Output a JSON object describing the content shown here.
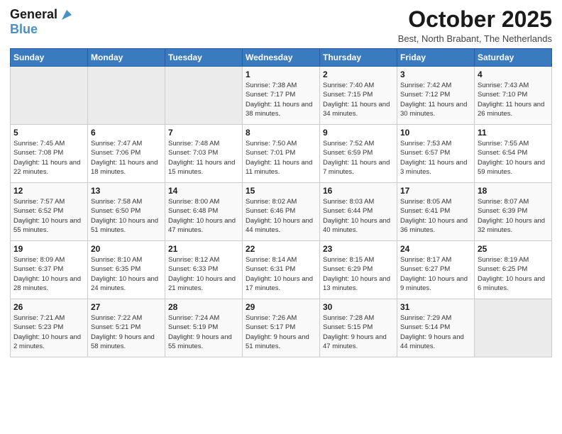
{
  "header": {
    "logo_line1": "General",
    "logo_line2": "Blue",
    "month": "October 2025",
    "location": "Best, North Brabant, The Netherlands"
  },
  "days_of_week": [
    "Sunday",
    "Monday",
    "Tuesday",
    "Wednesday",
    "Thursday",
    "Friday",
    "Saturday"
  ],
  "weeks": [
    [
      {
        "day": "",
        "info": ""
      },
      {
        "day": "",
        "info": ""
      },
      {
        "day": "",
        "info": ""
      },
      {
        "day": "1",
        "info": "Sunrise: 7:38 AM\nSunset: 7:17 PM\nDaylight: 11 hours\nand 38 minutes."
      },
      {
        "day": "2",
        "info": "Sunrise: 7:40 AM\nSunset: 7:15 PM\nDaylight: 11 hours\nand 34 minutes."
      },
      {
        "day": "3",
        "info": "Sunrise: 7:42 AM\nSunset: 7:12 PM\nDaylight: 11 hours\nand 30 minutes."
      },
      {
        "day": "4",
        "info": "Sunrise: 7:43 AM\nSunset: 7:10 PM\nDaylight: 11 hours\nand 26 minutes."
      }
    ],
    [
      {
        "day": "5",
        "info": "Sunrise: 7:45 AM\nSunset: 7:08 PM\nDaylight: 11 hours\nand 22 minutes."
      },
      {
        "day": "6",
        "info": "Sunrise: 7:47 AM\nSunset: 7:06 PM\nDaylight: 11 hours\nand 18 minutes."
      },
      {
        "day": "7",
        "info": "Sunrise: 7:48 AM\nSunset: 7:03 PM\nDaylight: 11 hours\nand 15 minutes."
      },
      {
        "day": "8",
        "info": "Sunrise: 7:50 AM\nSunset: 7:01 PM\nDaylight: 11 hours\nand 11 minutes."
      },
      {
        "day": "9",
        "info": "Sunrise: 7:52 AM\nSunset: 6:59 PM\nDaylight: 11 hours\nand 7 minutes."
      },
      {
        "day": "10",
        "info": "Sunrise: 7:53 AM\nSunset: 6:57 PM\nDaylight: 11 hours\nand 3 minutes."
      },
      {
        "day": "11",
        "info": "Sunrise: 7:55 AM\nSunset: 6:54 PM\nDaylight: 10 hours\nand 59 minutes."
      }
    ],
    [
      {
        "day": "12",
        "info": "Sunrise: 7:57 AM\nSunset: 6:52 PM\nDaylight: 10 hours\nand 55 minutes."
      },
      {
        "day": "13",
        "info": "Sunrise: 7:58 AM\nSunset: 6:50 PM\nDaylight: 10 hours\nand 51 minutes."
      },
      {
        "day": "14",
        "info": "Sunrise: 8:00 AM\nSunset: 6:48 PM\nDaylight: 10 hours\nand 47 minutes."
      },
      {
        "day": "15",
        "info": "Sunrise: 8:02 AM\nSunset: 6:46 PM\nDaylight: 10 hours\nand 44 minutes."
      },
      {
        "day": "16",
        "info": "Sunrise: 8:03 AM\nSunset: 6:44 PM\nDaylight: 10 hours\nand 40 minutes."
      },
      {
        "day": "17",
        "info": "Sunrise: 8:05 AM\nSunset: 6:41 PM\nDaylight: 10 hours\nand 36 minutes."
      },
      {
        "day": "18",
        "info": "Sunrise: 8:07 AM\nSunset: 6:39 PM\nDaylight: 10 hours\nand 32 minutes."
      }
    ],
    [
      {
        "day": "19",
        "info": "Sunrise: 8:09 AM\nSunset: 6:37 PM\nDaylight: 10 hours\nand 28 minutes."
      },
      {
        "day": "20",
        "info": "Sunrise: 8:10 AM\nSunset: 6:35 PM\nDaylight: 10 hours\nand 24 minutes."
      },
      {
        "day": "21",
        "info": "Sunrise: 8:12 AM\nSunset: 6:33 PM\nDaylight: 10 hours\nand 21 minutes."
      },
      {
        "day": "22",
        "info": "Sunrise: 8:14 AM\nSunset: 6:31 PM\nDaylight: 10 hours\nand 17 minutes."
      },
      {
        "day": "23",
        "info": "Sunrise: 8:15 AM\nSunset: 6:29 PM\nDaylight: 10 hours\nand 13 minutes."
      },
      {
        "day": "24",
        "info": "Sunrise: 8:17 AM\nSunset: 6:27 PM\nDaylight: 10 hours\nand 9 minutes."
      },
      {
        "day": "25",
        "info": "Sunrise: 8:19 AM\nSunset: 6:25 PM\nDaylight: 10 hours\nand 6 minutes."
      }
    ],
    [
      {
        "day": "26",
        "info": "Sunrise: 7:21 AM\nSunset: 5:23 PM\nDaylight: 10 hours\nand 2 minutes."
      },
      {
        "day": "27",
        "info": "Sunrise: 7:22 AM\nSunset: 5:21 PM\nDaylight: 9 hours\nand 58 minutes."
      },
      {
        "day": "28",
        "info": "Sunrise: 7:24 AM\nSunset: 5:19 PM\nDaylight: 9 hours\nand 55 minutes."
      },
      {
        "day": "29",
        "info": "Sunrise: 7:26 AM\nSunset: 5:17 PM\nDaylight: 9 hours\nand 51 minutes."
      },
      {
        "day": "30",
        "info": "Sunrise: 7:28 AM\nSunset: 5:15 PM\nDaylight: 9 hours\nand 47 minutes."
      },
      {
        "day": "31",
        "info": "Sunrise: 7:29 AM\nSunset: 5:14 PM\nDaylight: 9 hours\nand 44 minutes."
      },
      {
        "day": "",
        "info": ""
      }
    ]
  ]
}
